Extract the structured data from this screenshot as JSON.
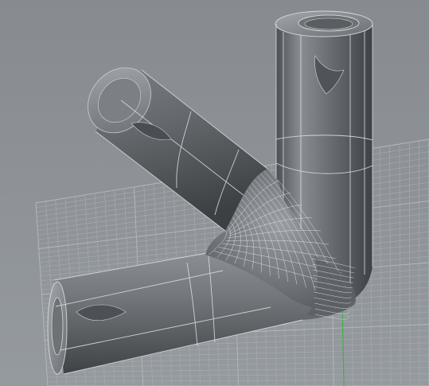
{
  "viewport": {
    "background": "#8d9196",
    "grid_color": "#a9adb2",
    "model_color": "#6b6f73",
    "x_axis_color": "#b0504a",
    "y_axis_color": "#3fae4a",
    "model": "three-pipe-elbow-junction"
  }
}
